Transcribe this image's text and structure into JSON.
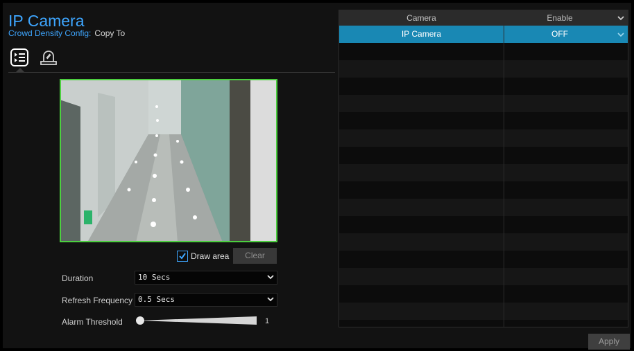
{
  "header": {
    "title": "IP Camera",
    "config_label": "Crowd Density Config:",
    "copy_to": "Copy To"
  },
  "tabs": [
    {
      "icon": "settings-list-icon",
      "active": true
    },
    {
      "icon": "alarm-light-icon",
      "active": false
    }
  ],
  "preview": {
    "draw_area_label": "Draw area",
    "draw_area_checked": true,
    "clear_label": "Clear"
  },
  "form": {
    "duration_label": "Duration",
    "duration_value": "10 Secs",
    "refresh_label": "Refresh Frequency",
    "refresh_value": "0.5 Secs",
    "threshold_label": "Alarm Threshold",
    "threshold_value": "1"
  },
  "table": {
    "columns": [
      "Camera",
      "Enable"
    ],
    "rows": [
      {
        "camera": "IP Camera",
        "enable": "OFF",
        "selected": true
      }
    ]
  },
  "footer": {
    "apply_label": "Apply"
  },
  "colors": {
    "accent": "#3ea6ff",
    "selected_row": "#1988b4",
    "detection_border": "#4ccf3f"
  }
}
